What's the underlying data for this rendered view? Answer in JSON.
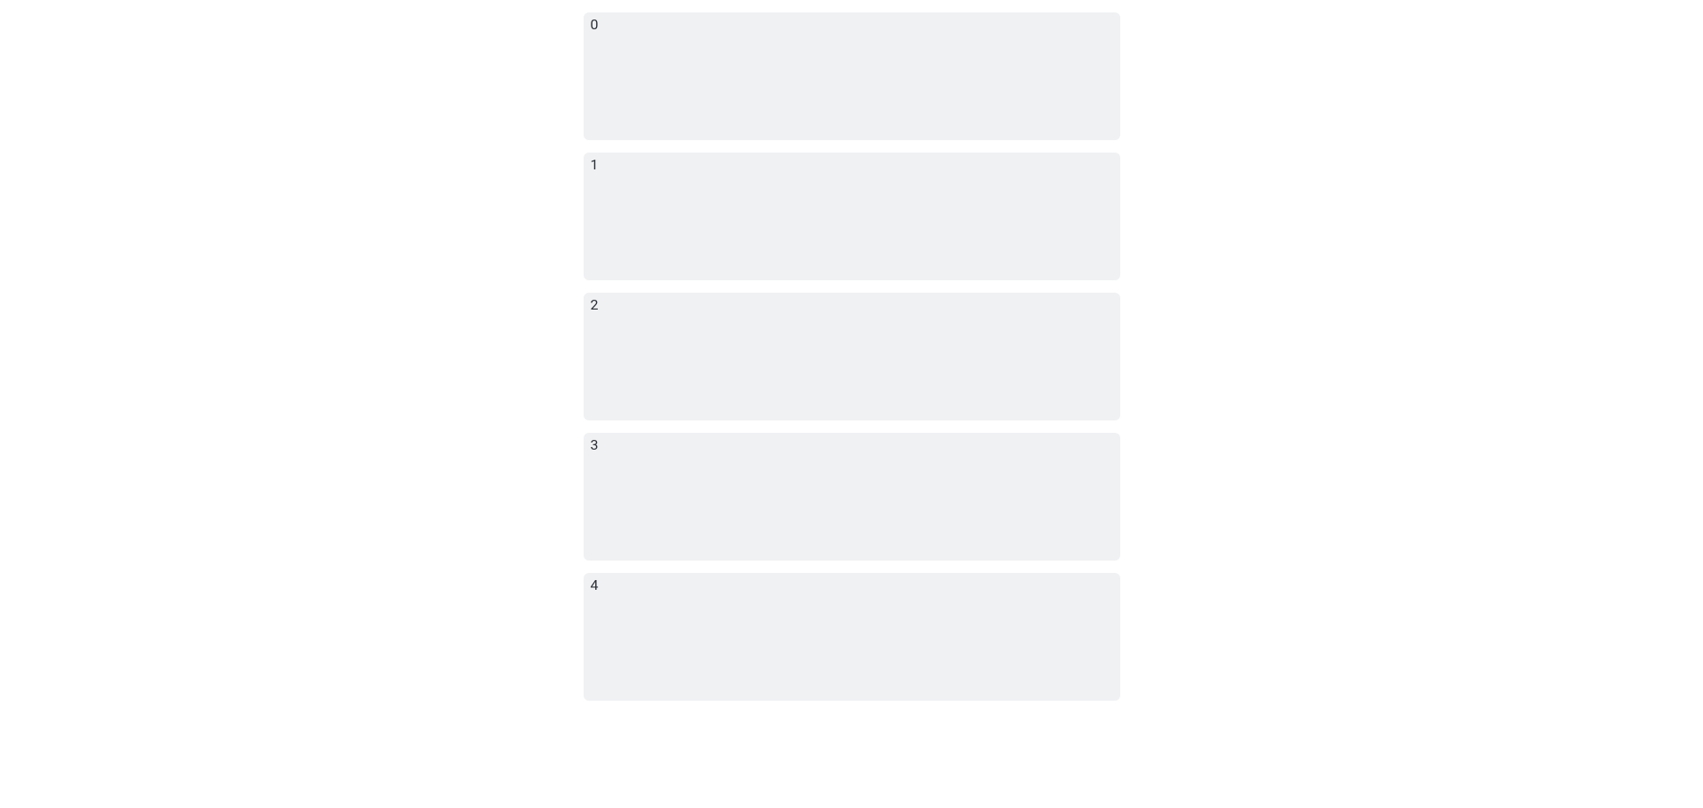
{
  "cards": [
    {
      "label": "0"
    },
    {
      "label": "1"
    },
    {
      "label": "2"
    },
    {
      "label": "3"
    },
    {
      "label": "4"
    }
  ],
  "colors": {
    "cardBackground": "#f0f1f3",
    "text": "#2b2f36",
    "pageBackground": "#ffffff"
  }
}
